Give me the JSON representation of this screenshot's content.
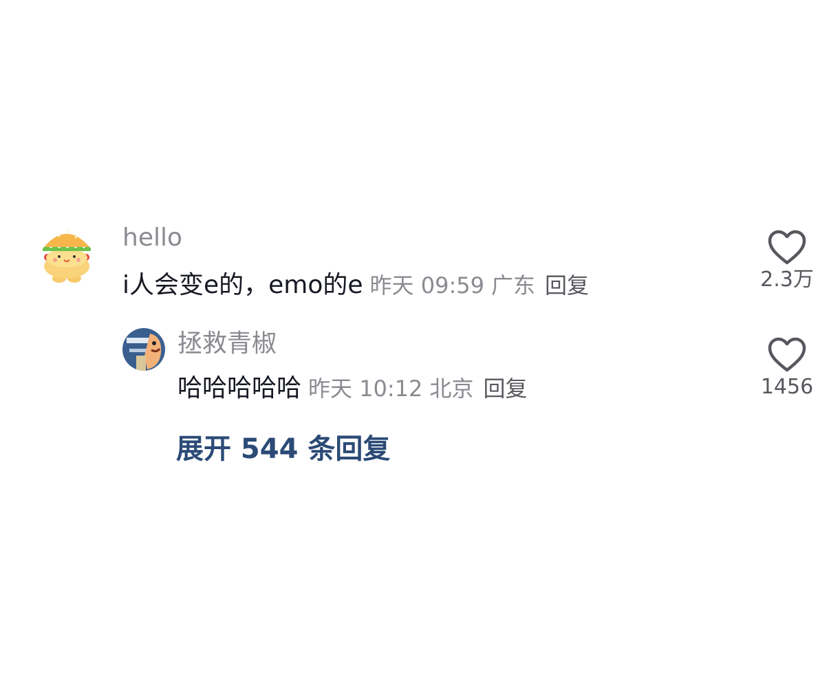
{
  "comments": [
    {
      "username": "hello",
      "text": "i人会变e的，emo的e",
      "time": "昨天 09:59",
      "location": "广东",
      "reply_label": "回复",
      "likes": "2.3万",
      "avatar": "burger-avatar"
    },
    {
      "username": "拯救青椒",
      "text": "哈哈哈哈哈",
      "time": "昨天 10:12",
      "location": "北京",
      "reply_label": "回复",
      "likes": "1456",
      "avatar": "cartoon-avatar"
    }
  ],
  "expand_replies": "展开 544 条回复",
  "colors": {
    "primary_text": "#161823",
    "secondary_text": "#8a8b91",
    "link": "#2b4a76"
  },
  "icons": {
    "like": "heart-outline-icon"
  }
}
